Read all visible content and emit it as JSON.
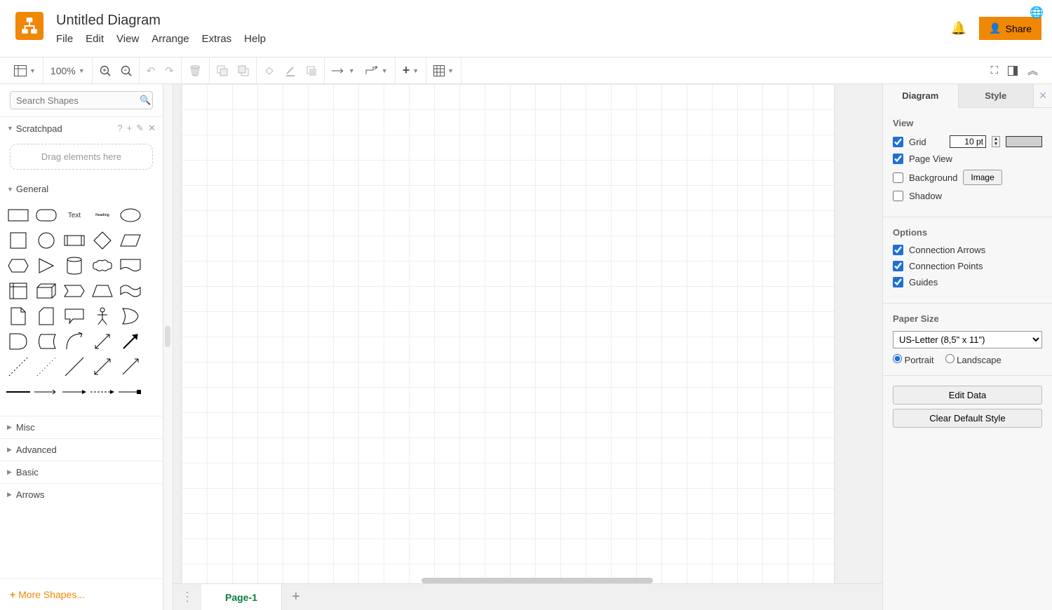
{
  "header": {
    "title": "Untitled Diagram",
    "menu": [
      "File",
      "Edit",
      "View",
      "Arrange",
      "Extras",
      "Help"
    ],
    "share_label": "Share"
  },
  "toolbar": {
    "zoom": "100%"
  },
  "sidebar": {
    "search_placeholder": "Search Shapes",
    "scratchpad_label": "Scratchpad",
    "scratchpad_drop": "Drag elements here",
    "general_label": "General",
    "text_shape": "Text",
    "heading_shape": "Heading",
    "categories": [
      "Misc",
      "Advanced",
      "Basic",
      "Arrows"
    ],
    "more_shapes": "More Shapes..."
  },
  "pages": {
    "current": "Page-1"
  },
  "rightpanel": {
    "tabs": [
      "Diagram",
      "Style"
    ],
    "view": {
      "title": "View",
      "grid": {
        "label": "Grid",
        "checked": true,
        "value": "10 pt"
      },
      "page_view": {
        "label": "Page View",
        "checked": true
      },
      "background": {
        "label": "Background",
        "checked": false,
        "image_btn": "Image"
      },
      "shadow": {
        "label": "Shadow",
        "checked": false
      }
    },
    "options": {
      "title": "Options",
      "connection_arrows": {
        "label": "Connection Arrows",
        "checked": true
      },
      "connection_points": {
        "label": "Connection Points",
        "checked": true
      },
      "guides": {
        "label": "Guides",
        "checked": true
      }
    },
    "papersize": {
      "title": "Paper Size",
      "selected": "US-Letter (8,5\" x 11\")",
      "portrait": "Portrait",
      "landscape": "Landscape",
      "orientation": "portrait"
    },
    "edit_data": "Edit Data",
    "clear_style": "Clear Default Style"
  }
}
